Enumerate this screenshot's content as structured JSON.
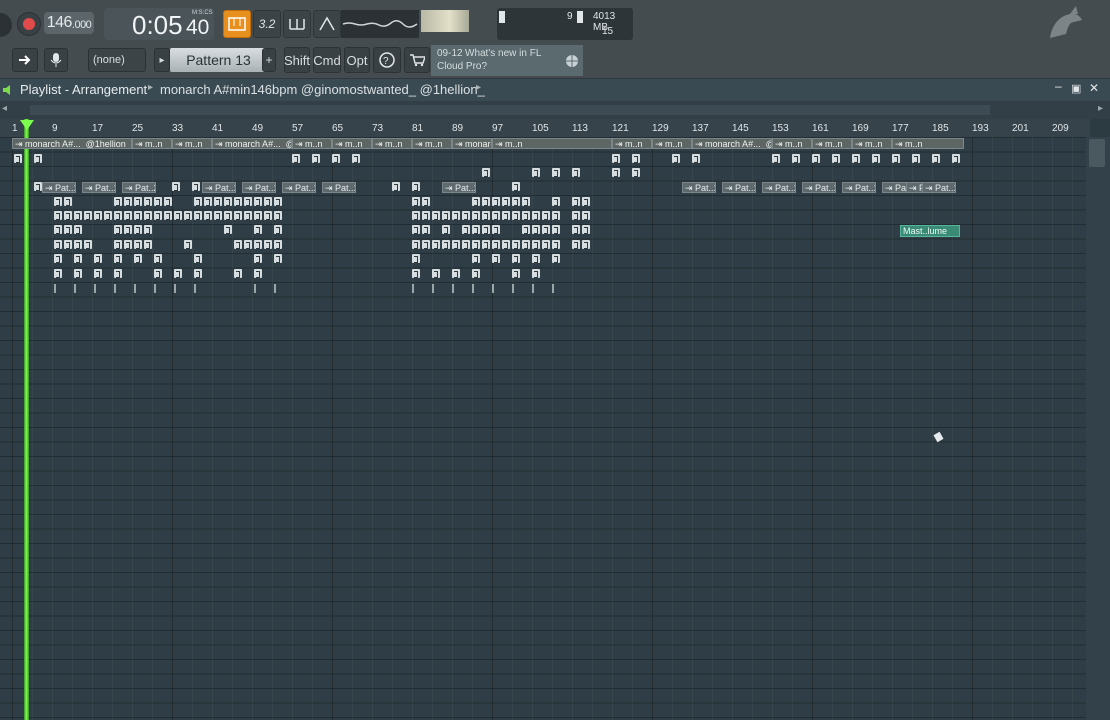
{
  "transport": {
    "tempo_int": "146",
    "tempo_dec": ".000",
    "time_main": "0:05",
    "time_cs": "40",
    "time_unit_label": "M:S:CS",
    "snap_label": "3.2",
    "sys_value_left": "9",
    "sys_memory": "4013 MB",
    "sys_polyphony": "15"
  },
  "toolbar2": {
    "channel_select": "(none)",
    "pattern_label": "Pattern 13",
    "mod_shift": "Shift",
    "mod_cmd": "Cmd",
    "mod_opt": "Opt",
    "news_date": "09-12",
    "news_text_1": "What's new in FL",
    "news_text_2": "Cloud Pro?"
  },
  "playlist": {
    "title": "Playlist - Arrangement",
    "breadcrumb": "monarch A#min146bpm @ginomostwanted_ @1hellion_"
  },
  "ruler": [
    "1",
    "9",
    "17",
    "25",
    "33",
    "41",
    "49",
    "57",
    "65",
    "73",
    "81",
    "89",
    "97",
    "105",
    "113",
    "121",
    "129",
    "137",
    "145",
    "153",
    "161",
    "169",
    "177",
    "185",
    "193",
    "201",
    "209"
  ],
  "audio_clips": [
    "monarch A#..._@1hellion_",
    "m..n_",
    "m..n_",
    "monarch A#..._@1hellion_",
    "m..n_",
    "m..n_",
    "m..n_",
    "m..n_",
    "monarch A#..._@1hellion_",
    "m..n_",
    "m..n_",
    "m..n_",
    "monarch A#..._@1hellion_",
    "m..n_",
    "m..n_",
    "m..n_",
    "m..n_"
  ],
  "pattern_clips": [
    "Pat..1",
    "Pat..1",
    "Pat..2",
    "Pat..1",
    "Pat..1",
    "Pat..1",
    "Pat..1",
    "Pat..1",
    "Pat..1",
    "Pat..1",
    "Pat..1",
    "Pat..1",
    "Pat..1",
    "Pat..1",
    "Pat..3",
    "Pat..1"
  ],
  "automation_clip": "Mast..lume",
  "colors": {
    "playhead": "#6cff3a",
    "accent": "#f08a00"
  }
}
